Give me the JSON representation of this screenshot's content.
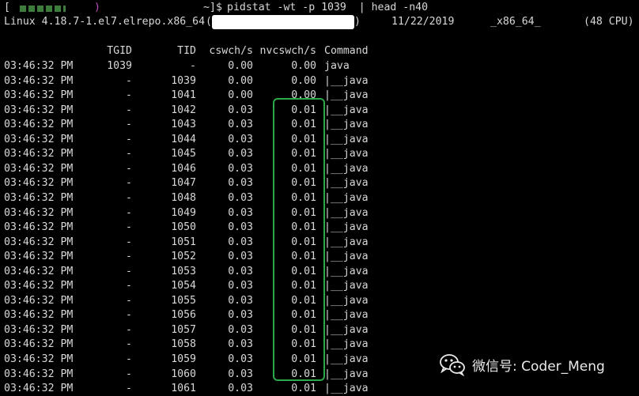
{
  "prompt": {
    "open": "[",
    "close": "]$",
    "user_tail": ")",
    "host_tail": "~",
    "command": "pidstat -wt -p 1039  | head -n40"
  },
  "sysinfo": {
    "kernel": "Linux 4.18.7-1.el7.elrepo.x86_64",
    "host_open": "(",
    "host_close": ")",
    "date": "11/22/2019",
    "arch": "_x86_64_",
    "cpus": "(48 CPU)"
  },
  "table": {
    "headers": [
      "TGID",
      "TID",
      "cswch/s",
      "nvcswch/s",
      "Command"
    ],
    "rows": [
      [
        "03:46:32 PM",
        "1039",
        "-",
        "0.00",
        "0.00",
        "java"
      ],
      [
        "03:46:32 PM",
        "-",
        "1039",
        "0.00",
        "0.00",
        "|__java"
      ],
      [
        "03:46:32 PM",
        "-",
        "1041",
        "0.00",
        "0.00",
        "|__java"
      ],
      [
        "03:46:32 PM",
        "-",
        "1042",
        "0.03",
        "0.01",
        "|__java"
      ],
      [
        "03:46:32 PM",
        "-",
        "1043",
        "0.03",
        "0.01",
        "|__java"
      ],
      [
        "03:46:32 PM",
        "-",
        "1044",
        "0.03",
        "0.01",
        "|__java"
      ],
      [
        "03:46:32 PM",
        "-",
        "1045",
        "0.03",
        "0.01",
        "|__java"
      ],
      [
        "03:46:32 PM",
        "-",
        "1046",
        "0.03",
        "0.01",
        "|__java"
      ],
      [
        "03:46:32 PM",
        "-",
        "1047",
        "0.03",
        "0.01",
        "|__java"
      ],
      [
        "03:46:32 PM",
        "-",
        "1048",
        "0.03",
        "0.01",
        "|__java"
      ],
      [
        "03:46:32 PM",
        "-",
        "1049",
        "0.03",
        "0.01",
        "|__java"
      ],
      [
        "03:46:32 PM",
        "-",
        "1050",
        "0.03",
        "0.01",
        "|__java"
      ],
      [
        "03:46:32 PM",
        "-",
        "1051",
        "0.03",
        "0.01",
        "|__java"
      ],
      [
        "03:46:32 PM",
        "-",
        "1052",
        "0.03",
        "0.01",
        "|__java"
      ],
      [
        "03:46:32 PM",
        "-",
        "1053",
        "0.03",
        "0.01",
        "|__java"
      ],
      [
        "03:46:32 PM",
        "-",
        "1054",
        "0.03",
        "0.01",
        "|__java"
      ],
      [
        "03:46:32 PM",
        "-",
        "1055",
        "0.03",
        "0.01",
        "|__java"
      ],
      [
        "03:46:32 PM",
        "-",
        "1056",
        "0.03",
        "0.01",
        "|__java"
      ],
      [
        "03:46:32 PM",
        "-",
        "1057",
        "0.03",
        "0.01",
        "|__java"
      ],
      [
        "03:46:32 PM",
        "-",
        "1058",
        "0.03",
        "0.01",
        "|__java"
      ],
      [
        "03:46:32 PM",
        "-",
        "1059",
        "0.03",
        "0.01",
        "|__java"
      ],
      [
        "03:46:32 PM",
        "-",
        "1060",
        "0.03",
        "0.01",
        "|__java"
      ],
      [
        "03:46:32 PM",
        "-",
        "1061",
        "0.03",
        "0.01",
        "|__java"
      ]
    ]
  },
  "watermark": {
    "text": "微信号: Coder_Meng",
    "icon": "wechat-icon"
  },
  "colors": {
    "background": "#000000",
    "text": "#d8d8d8",
    "highlight": "#2aa84a"
  }
}
